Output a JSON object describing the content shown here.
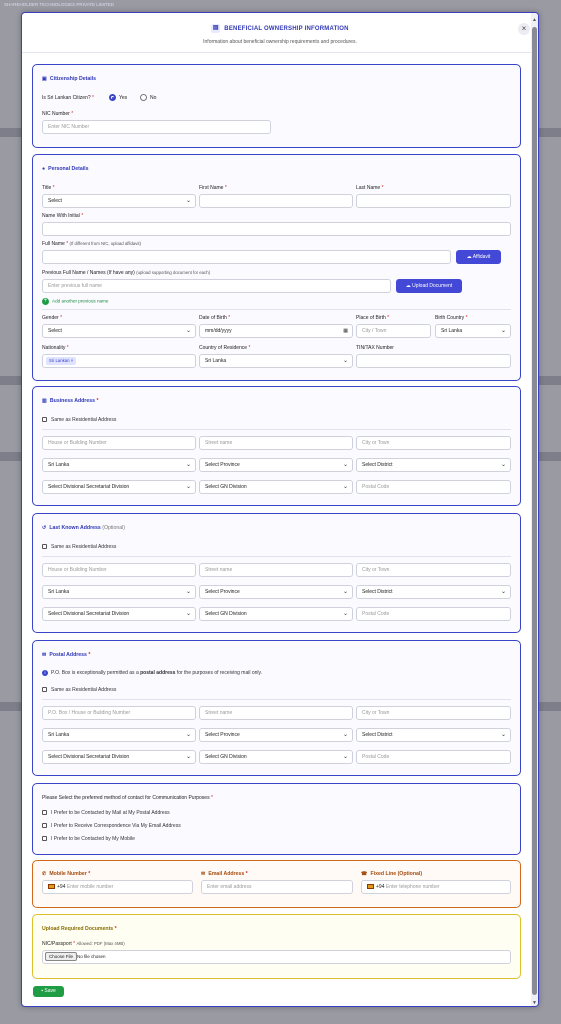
{
  "background": {
    "top_text": "SHAREHOLDER   TECHNOLOGIES   PRIVATE LIMITED"
  },
  "modal": {
    "title": "BENEFICIAL OWNERSHIP INFORMATION",
    "title_icon": "document-icon",
    "subtitle": "Information about beneficial ownership requirements and procedures.",
    "close": "×"
  },
  "citizenship": {
    "title": "Citizenship Details",
    "question": "Is Sri Lankan Citizen?",
    "req": "*",
    "opt_yes": "Yes",
    "opt_no": "No",
    "selected": "Yes",
    "nic_label": "NIC Number",
    "nic_placeholder": "Enter NIC Number"
  },
  "personal": {
    "title": "Personal Details",
    "title_label": "Title",
    "title_value": "Select",
    "first_name_label": "First Name",
    "last_name_label": "Last Name",
    "initial_label": "Name With Initial",
    "full_name_label": "Full Name",
    "full_name_hint": "(If different from NIC, upload affidavit)",
    "affidavit_btn": "Affidavit",
    "prev_label": "Previous Full Name / Names (If have any)",
    "prev_hint": "(upload supporting document for each)",
    "prev_placeholder": "Enter previous full name",
    "upload_btn": "Upload Document",
    "add_prev": "Add another previous name",
    "gender_label": "Gender",
    "gender_value": "Select",
    "dob_label": "Date of Birth",
    "dob_value": "mm/dd/yyyy",
    "pob_label": "Place of Birth",
    "pob_placeholder": "City / Town",
    "birth_country_label": "Birth Country",
    "birth_country_value": "Sri Lanka",
    "nationality_label": "Nationality",
    "nationality_tag": "Sri Lankan ×",
    "residence_label": "Country of Residence",
    "residence_value": "Sri Lanka",
    "tin_label": "TIN/TAX Number"
  },
  "business": {
    "title": "Business Address",
    "same": "Same as Residential Address",
    "house_ph": "House or Building Number",
    "street_ph": "Street name",
    "city_ph": "City or Town",
    "country": "Sri Lanka",
    "province": "Select Province",
    "district": "Select District",
    "dsd": "Select Divisional Secretariat Division",
    "gn": "Select GN Division",
    "postal_ph": "Postal Code"
  },
  "last_known": {
    "title": "Last Known Address",
    "optional": "(Optional)",
    "same": "Same as Residential Address",
    "house_ph": "House or Building Number",
    "street_ph": "Street name",
    "city_ph": "City or Town",
    "country": "Sri Lanka",
    "province": "Select Province",
    "district": "Select District",
    "dsd": "Select Divisional Secretariat Division",
    "gn": "Select GN Division",
    "postal_ph": "Postal Code"
  },
  "postal": {
    "title": "Postal Address",
    "note_a": "P.O. Box is exceptionally permitted as a ",
    "note_b": "postal address",
    "note_c": " for the purposes of receiving mail only.",
    "same": "Same as Residential Address",
    "house_ph": "P.O. Box / House or Building Number",
    "street_ph": "Street name",
    "city_ph": "City or Town",
    "country": "Sri Lanka",
    "province": "Select Province",
    "district": "Select District",
    "dsd": "Select Divisional Secretariat Division",
    "gn": "Select GN Division",
    "postal_ph": "Postal Code"
  },
  "contact_pref": {
    "question": "Please Select the preferred method of contact for Communication Purposes",
    "opt1": "I Prefer to be Contacted by Mail at My Postal Address",
    "opt2": "I Prefer to Receive Correspondence Via My Email Address",
    "opt3": "I Prefer to be Contacted by My Mobile"
  },
  "contact": {
    "mobile_label": "Mobile Number",
    "mobile_code": "+94",
    "mobile_ph": "Enter mobile number",
    "email_label": "Email Address",
    "email_ph": "Enter email address",
    "fixed_label": "Fixed Line (Optional)",
    "fixed_code": "+94",
    "fixed_ph": "Enter telephone number"
  },
  "documents": {
    "title": "Upload Required Documents",
    "nic_label": "NIC/Passport",
    "nic_hint": "Allowed: PDF (Max 4MB)",
    "choose": "Choose File",
    "no_file": "No file chosen"
  },
  "save_btn": "Save",
  "colors": {
    "primary": "#3a44c9",
    "orange": "#d2691e",
    "yellow": "#dcc12d",
    "green": "#1f9d45"
  }
}
